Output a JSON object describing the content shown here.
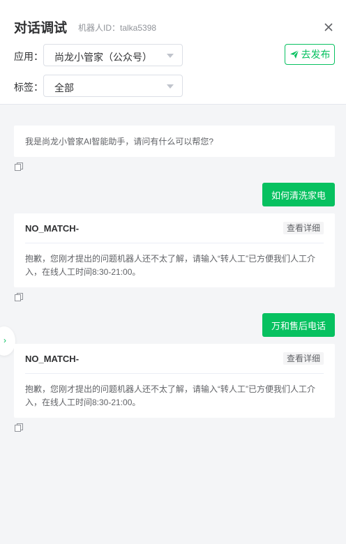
{
  "header": {
    "title": "对话调试",
    "bot_id": "机器人ID：talka5398",
    "app_label": "应用：",
    "app_value": "尚龙小管家（公众号）",
    "tag_label": "标签：",
    "tag_value": "全部",
    "publish_label": "去发布"
  },
  "chat": {
    "greeting": "我是尚龙小管家AI智能助手，请问有什么可以帮您?",
    "messages": [
      {
        "user": "如何清洗家电",
        "code": "NO_MATCH-",
        "detail_label": "查看详细",
        "reply": "抱歉，您刚才提出的问题机器人还不太了解，请输入“转人工”已方便我们人工介入，在线人工时间8:30-21:00。"
      },
      {
        "user": "万和售后电话",
        "code": "NO_MATCH-",
        "detail_label": "查看详细",
        "reply": "抱歉，您刚才提出的问题机器人还不太了解，请输入“转人工”已方便我们人工介入，在线人工时间8:30-21:00。"
      }
    ]
  },
  "sidebar_toggle": "›",
  "icons": [
    "close-icon",
    "send-icon",
    "copy-icon",
    "chevron-right-icon",
    "caret-down-icon"
  ],
  "colors": {
    "accent": "#07c160",
    "background": "#f4f5f7"
  }
}
